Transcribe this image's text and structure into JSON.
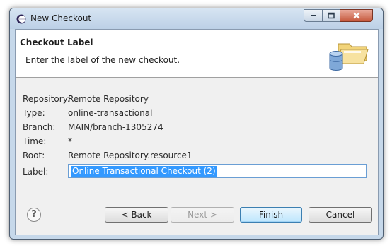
{
  "window": {
    "title": "New Checkout",
    "title_icon": "eclipse-icon",
    "controls": [
      "minimize-icon",
      "maximize-icon",
      "close-icon"
    ]
  },
  "banner": {
    "title": "Checkout Label",
    "description": "Enter the label of the new checkout.",
    "icon": "folder-database-icon"
  },
  "fields": {
    "repository": {
      "label": "Repository:",
      "value": "Remote Repository"
    },
    "type": {
      "label": "Type:",
      "value": "online-transactional"
    },
    "branch": {
      "label": "Branch:",
      "value": "MAIN/branch-1305274"
    },
    "time": {
      "label": "Time:",
      "value": "*"
    },
    "root": {
      "label": "Root:",
      "value": "Remote Repository.resource1"
    },
    "label": {
      "label": "Label:",
      "value": "Online Transactional Checkout (2)"
    }
  },
  "buttons": {
    "help_icon": "help-icon",
    "back": "< Back",
    "next": "Next >",
    "finish": "Finish",
    "cancel": "Cancel"
  },
  "colors": {
    "selection": "#3399ff",
    "default_button": "#bee6fd",
    "frame": "#c6d8ea"
  }
}
